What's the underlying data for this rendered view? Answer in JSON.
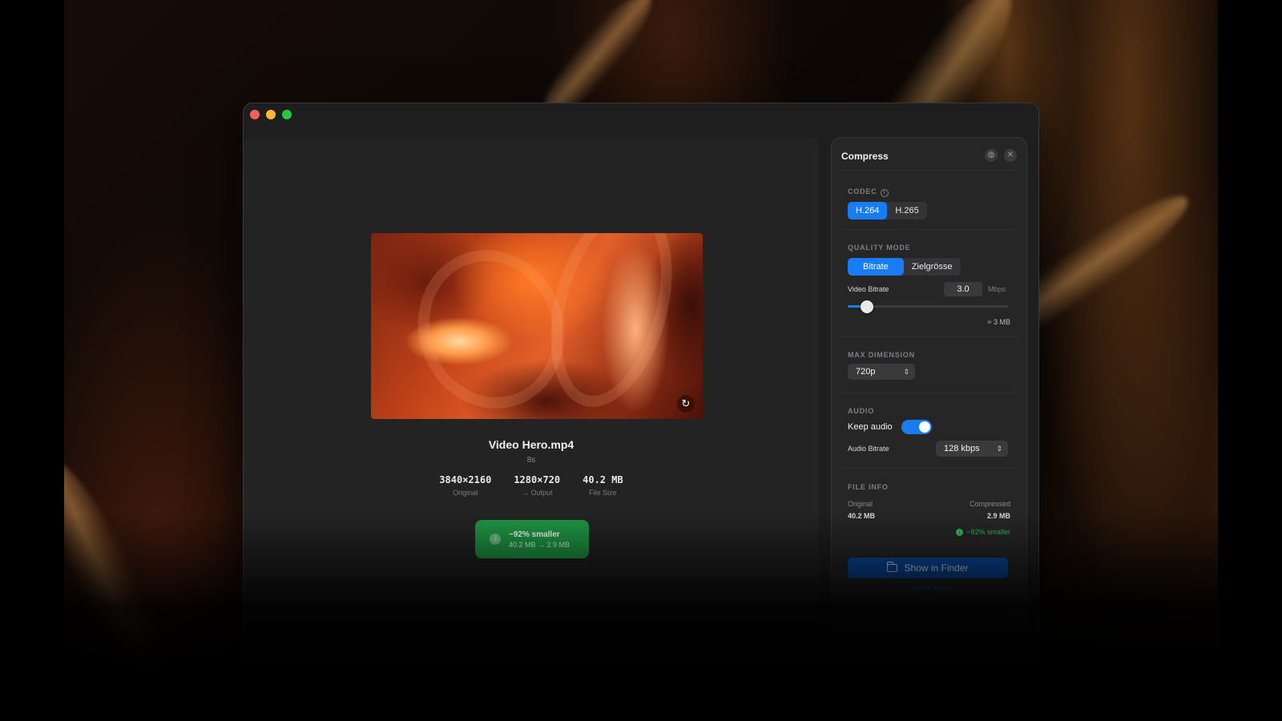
{
  "preview": {
    "file_name": "Video Hero.mp4",
    "duration": "8s",
    "reload_icon": "↻",
    "stats": [
      {
        "value": "3840×2160",
        "label": "Original"
      },
      {
        "value": "1280×720",
        "label": "→ Output"
      },
      {
        "value": "40.2 MB",
        "label": "File Size"
      }
    ],
    "result": {
      "title": "−92% smaller",
      "detail": "40.2 MB → 2.9 MB",
      "icon": "download-arrow"
    }
  },
  "panel": {
    "title": "Compress",
    "header_icons": [
      "globe-icon",
      "close-icon"
    ],
    "codec": {
      "label": "CODEC",
      "options": [
        "H.264",
        "H.265"
      ],
      "selected": "H.264"
    },
    "quality_mode": {
      "label": "QUALITY MODE",
      "options": [
        "Bitrate",
        "Zielgrösse"
      ],
      "selected": "Bitrate",
      "video_bitrate_label": "Video Bitrate",
      "video_bitrate_value": "3.0",
      "video_bitrate_unit": "Mbps",
      "slider_fraction": 0.12,
      "estimate": "≈ 3 MB"
    },
    "max_dimension": {
      "label": "MAX DIMENSION",
      "value": "720p"
    },
    "audio": {
      "label": "AUDIO",
      "keep_audio_label": "Keep audio",
      "keep_audio_on": true,
      "bitrate_label": "Audio Bitrate",
      "bitrate_value": "128 kbps"
    },
    "file_info": {
      "label": "FILE INFO",
      "original_label": "Original",
      "original_value": "40.2 MB",
      "compressed_label": "Compressed",
      "compressed_value": "2.9 MB",
      "saving": "−92% smaller"
    },
    "show_in_finder": "Show in Finder",
    "convert_again": "Convert Again"
  },
  "colors": {
    "accent": "#1a7cf2",
    "success": "#1f9a45",
    "finder_button": "#0a4fae"
  }
}
